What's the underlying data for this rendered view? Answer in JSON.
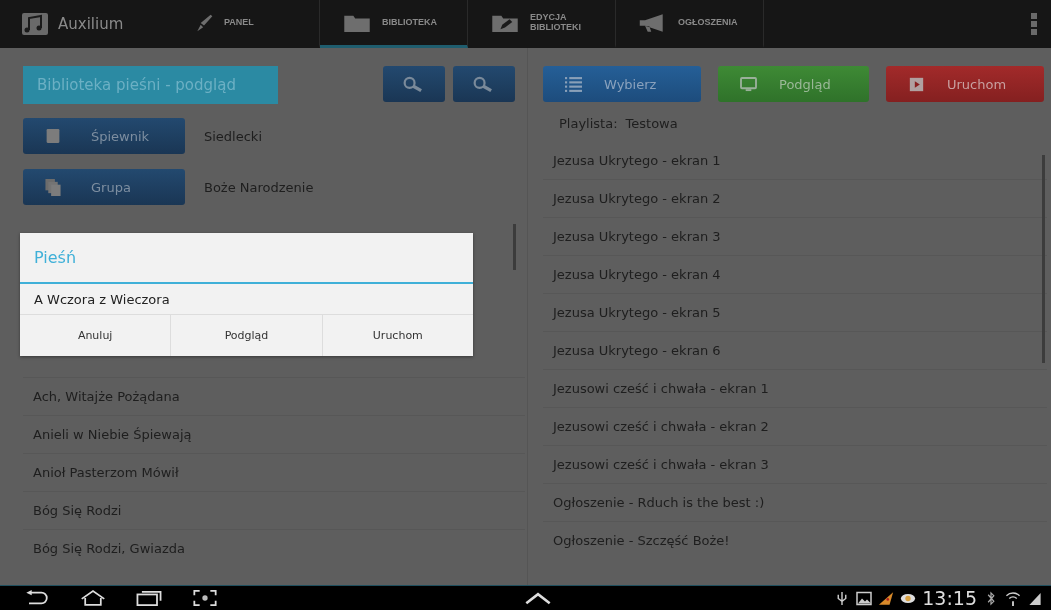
{
  "app": {
    "title": "Auxilium"
  },
  "tabs": [
    {
      "label": "PANEL",
      "selected": false,
      "kind": "pen"
    },
    {
      "label": "BIBLIOTEKA",
      "selected": true,
      "kind": "folder"
    },
    {
      "label": "EDYCJA BIBLIOTEKI",
      "selected": false,
      "kind": "folder-edit"
    },
    {
      "label": "OGŁOSZENIA",
      "selected": false,
      "kind": "megaphone"
    }
  ],
  "library": {
    "title": "Biblioteka pieśni - podgląd",
    "filters": [
      {
        "button": "Śpiewnik",
        "value": "Siedlecki",
        "kind": "book"
      },
      {
        "button": "Grupa",
        "value": "Boże Narodzenie",
        "kind": "stack"
      }
    ],
    "songs": [
      "Ach, Witajże Pożądana",
      "Anieli w Niebie Śpiewają",
      "Anioł Pasterzom Mówił",
      "Bóg Się Rodzi",
      "Bóg Się Rodzi, Gwiazda"
    ]
  },
  "dialog": {
    "title": "Pieśń",
    "item": "A Wczora z Wieczora",
    "buttons": [
      "Anuluj",
      "Podgląd",
      "Uruchom"
    ]
  },
  "playlist": {
    "actions": [
      {
        "label": "Wybierz",
        "kind": "select"
      },
      {
        "label": "Podgląd",
        "kind": "preview"
      },
      {
        "label": "Uruchom",
        "kind": "run"
      }
    ],
    "label": "Playlista:",
    "name": "Testowa",
    "items": [
      "Jezusa Ukrytego - ekran 1",
      "Jezusa Ukrytego - ekran 2",
      "Jezusa Ukrytego - ekran 3",
      "Jezusa Ukrytego - ekran 4",
      "Jezusa Ukrytego - ekran 5",
      "Jezusa Ukrytego - ekran 6",
      "Jezusowi cześć i chwała - ekran 1",
      "Jezusowi cześć i chwała - ekran 2",
      "Jezusowi cześć i chwała - ekran 3",
      "Ogłoszenie - Rduch is the best :)",
      "Ogłoszenie - Szczęść Boże!"
    ]
  },
  "status_bar": {
    "time": "13:15"
  }
}
